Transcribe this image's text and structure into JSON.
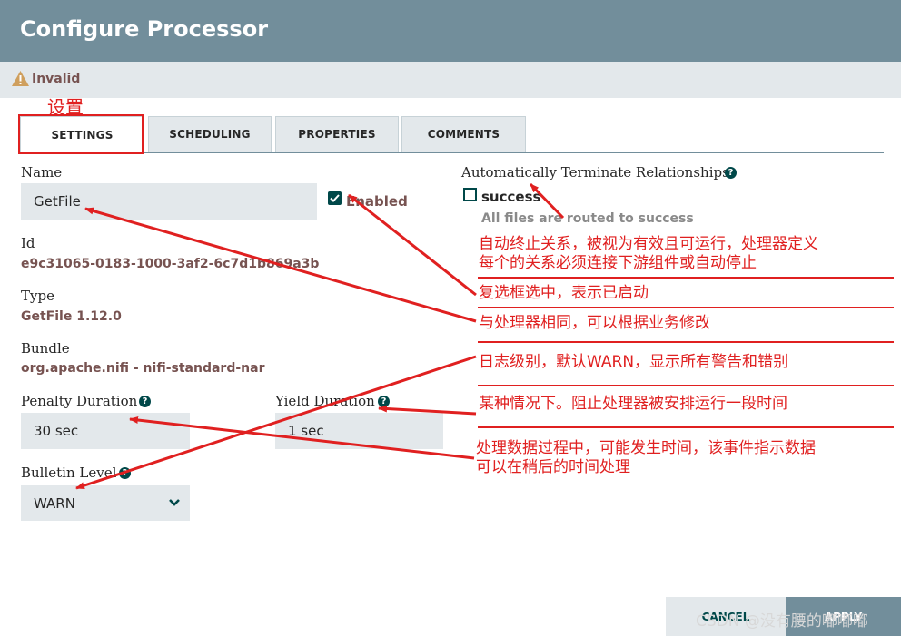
{
  "dialog": {
    "title": "Configure Processor"
  },
  "status": {
    "text": "Invalid",
    "icon": "warning-icon",
    "color": "#775351"
  },
  "tabs": [
    {
      "label": "SETTINGS",
      "active": true
    },
    {
      "label": "SCHEDULING",
      "active": false
    },
    {
      "label": "PROPERTIES",
      "active": false
    },
    {
      "label": "COMMENTS",
      "active": false
    }
  ],
  "annotation_tab_label": "设置",
  "settings": {
    "name_label": "Name",
    "name_value": "GetFile",
    "enabled_label": "Enabled",
    "enabled_checked": true,
    "id_label": "Id",
    "id_value": "e9c31065-0183-1000-3af2-6c7d1b869a3b",
    "type_label": "Type",
    "type_value": "GetFile 1.12.0",
    "bundle_label": "Bundle",
    "bundle_value": "org.apache.nifi - nifi-standard-nar",
    "penalty_label": "Penalty Duration",
    "penalty_value": "30 sec",
    "yield_label": "Yield Duration",
    "yield_value": "1 sec",
    "bulletin_label": "Bulletin Level",
    "bulletin_value": "WARN"
  },
  "relationships": {
    "label": "Automatically Terminate Relationships",
    "items": [
      {
        "name": "success",
        "checked": false,
        "description": "All files are routed to success"
      }
    ]
  },
  "annotations": [
    {
      "lines": [
        "自动终止关系，被视为有效且可运行，处理器定义",
        "每个的关系必须连接下游组件或自动停止"
      ]
    },
    {
      "lines": [
        "复选框选中，表示已启动"
      ]
    },
    {
      "lines": [
        "与处理器相同，可以根据业务修改"
      ]
    },
    {
      "lines": [
        "日志级别，默认WARN，显示所有警告和错别"
      ]
    },
    {
      "lines": [
        "某种情况下。阻止处理器被安排运行一段时间"
      ]
    },
    {
      "lines": [
        "处理数据过程中，可能发生时间，该事件指示数据",
        "可以在稍后的时间处理"
      ]
    }
  ],
  "footer": {
    "cancel_label": "CANCEL",
    "apply_label": "APPLY"
  },
  "watermark": "CSDN @没有腰的嘟嘟嘟",
  "colors": {
    "header": "#728e9b",
    "accent": "#004849",
    "annotation": "#e02020",
    "field_bg": "#e3e8eb"
  }
}
